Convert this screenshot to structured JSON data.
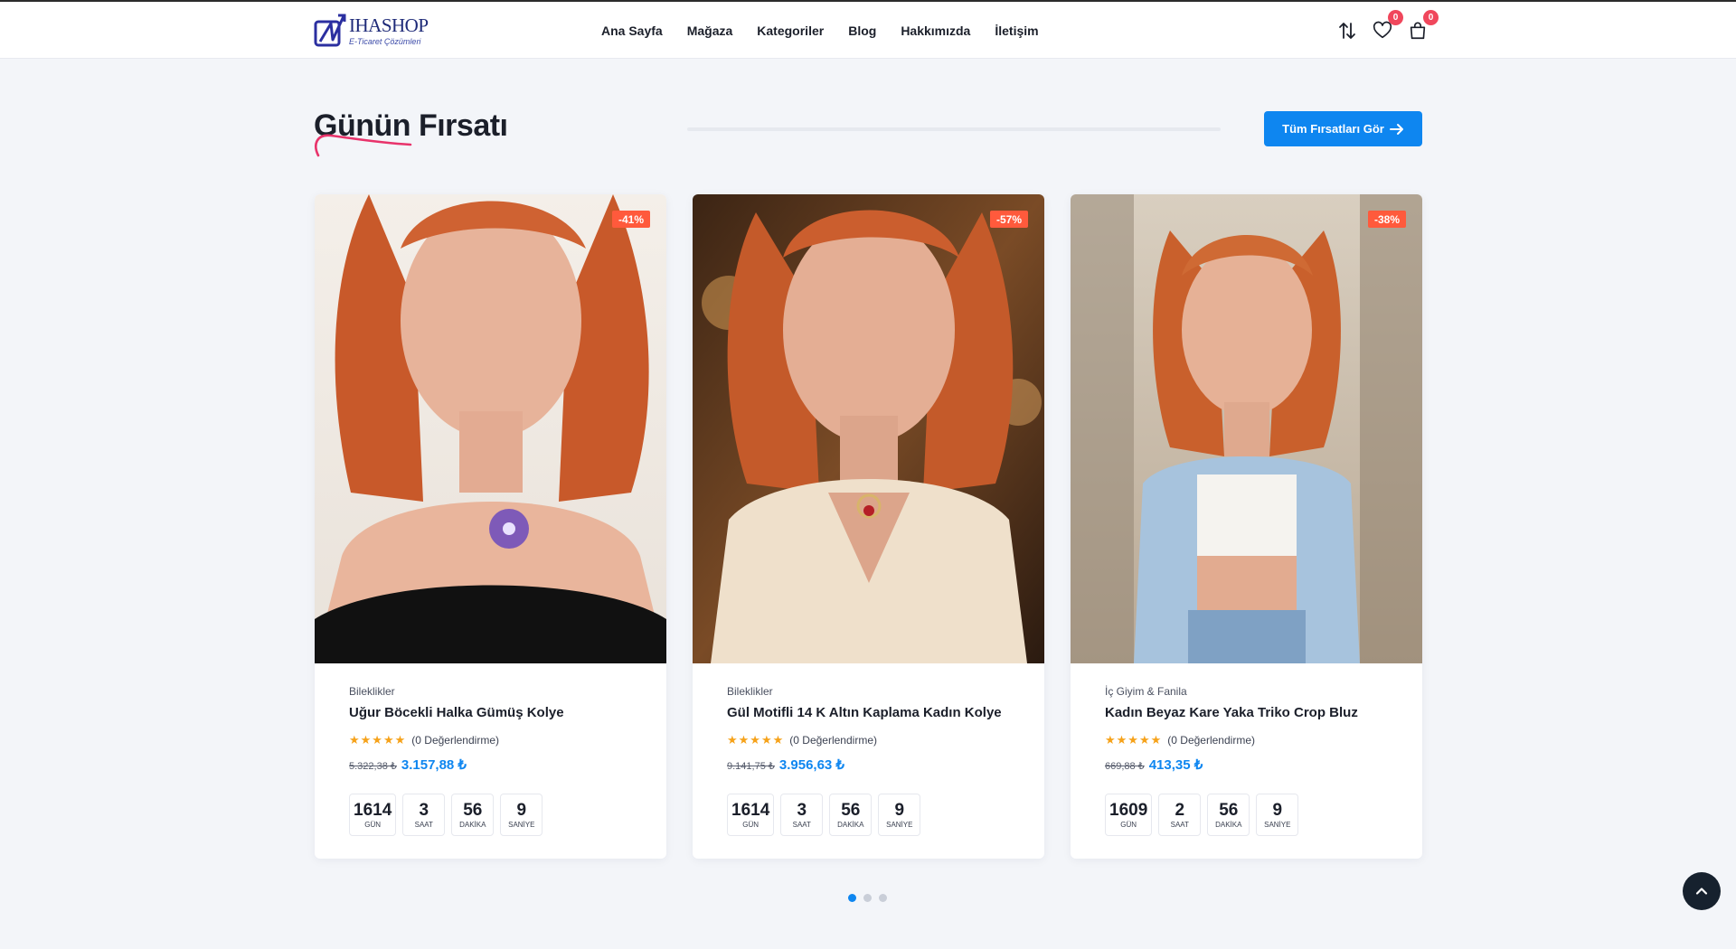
{
  "header": {
    "logo": {
      "name": "IHASHOP",
      "tagline": "E-Ticaret Çözümleri"
    },
    "nav": [
      "Ana Sayfa",
      "Mağaza",
      "Kategoriler",
      "Blog",
      "Hakkımızda",
      "İletişim"
    ],
    "icons": {
      "compare": "arrows-up-down-icon",
      "wishlist": "heart-icon",
      "cart": "bag-icon"
    },
    "wishlist_count": "0",
    "cart_count": "0"
  },
  "section": {
    "title": "Günün Fırsatı",
    "cta_label": "Tüm Fırsatları Gör"
  },
  "colors": {
    "accent": "#0e86f0",
    "discount": "#ff5a3c",
    "stars": "#f6a21a",
    "badge": "#f0475c"
  },
  "countdown_labels": {
    "days": "GÜN",
    "hours": "SAAT",
    "minutes": "DAKİKA",
    "seconds": "SANİYE"
  },
  "products": [
    {
      "discount": "-41%",
      "category": "Bileklikler",
      "name": "Uğur Böcekli Halka Gümüş Kolye",
      "stars": "★★★★★",
      "reviews": "(0 Değerlendirme)",
      "old_price": "5.322,38 ₺",
      "new_price": "3.157,88 ₺",
      "countdown": {
        "days": "1614",
        "hours": "3",
        "minutes": "56",
        "seconds": "9"
      }
    },
    {
      "discount": "-57%",
      "category": "Bileklikler",
      "name": "Gül Motifli 14 K Altın Kaplama Kadın Kolye",
      "stars": "★★★★★",
      "reviews": "(0 Değerlendirme)",
      "old_price": "9.141,75 ₺",
      "new_price": "3.956,63 ₺",
      "countdown": {
        "days": "1614",
        "hours": "3",
        "minutes": "56",
        "seconds": "9"
      }
    },
    {
      "discount": "-38%",
      "category": "İç Giyim & Fanila",
      "name": "Kadın Beyaz Kare Yaka Triko Crop Bluz",
      "stars": "★★★★★",
      "reviews": "(0 Değerlendirme)",
      "old_price": "669,88 ₺",
      "new_price": "413,35 ₺",
      "countdown": {
        "days": "1609",
        "hours": "2",
        "minutes": "56",
        "seconds": "9"
      }
    }
  ],
  "carousel": {
    "pages": 3,
    "active": 0
  }
}
